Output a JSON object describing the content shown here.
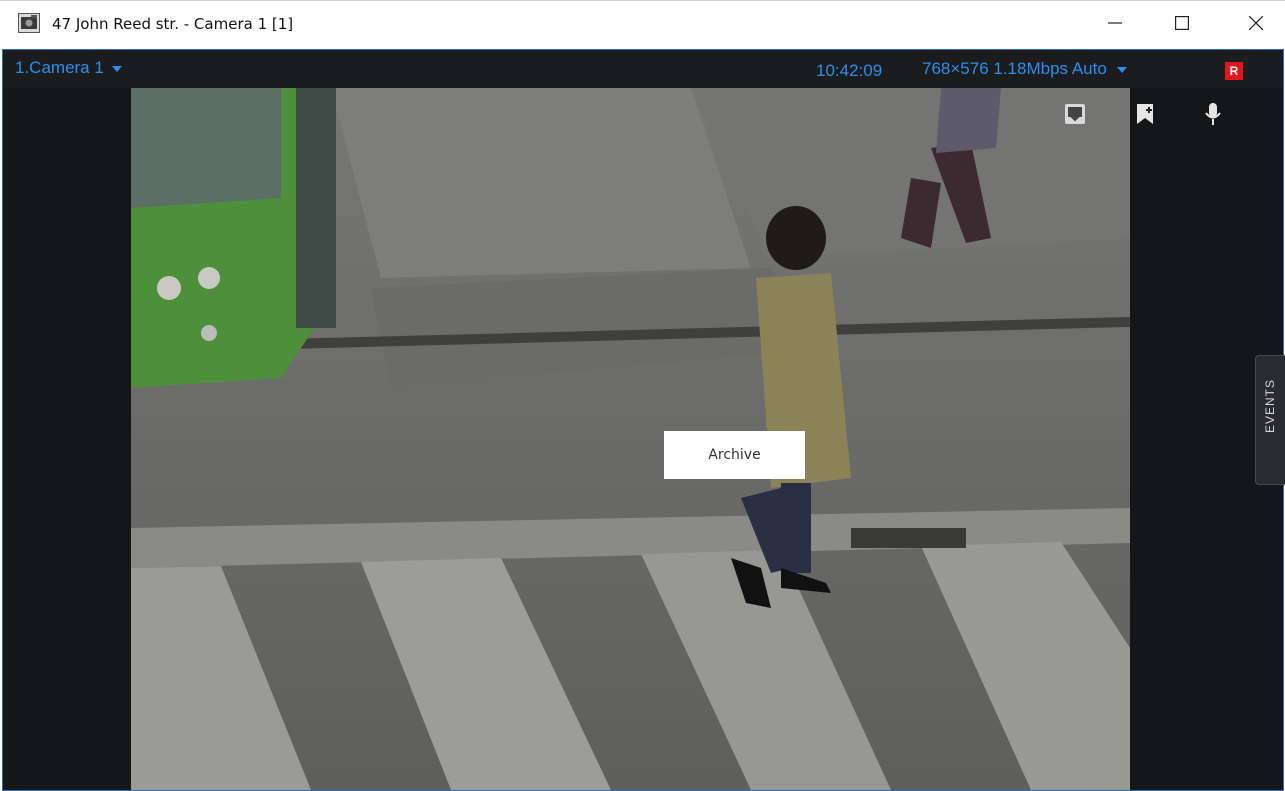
{
  "window": {
    "title": "47 John Reed str. - Camera 1 [1]",
    "icons": {
      "app": "camera-window-icon",
      "minimize": "minimize-icon",
      "maximize": "maximize-icon",
      "close": "close-icon"
    }
  },
  "camera": {
    "name": "1.Camera 1",
    "time": "10:42:09",
    "stream_info": "768×576 1.18Mbps Auto",
    "record_badge": "R",
    "accent_color": "#2b8fef",
    "record_color": "#e3141b",
    "controls": [
      "snapshot-icon",
      "bookmark-icon",
      "microphone-icon"
    ]
  },
  "side_panel": {
    "events_label": "EVENTS"
  },
  "overlay": {
    "archive_label": "Archive"
  }
}
